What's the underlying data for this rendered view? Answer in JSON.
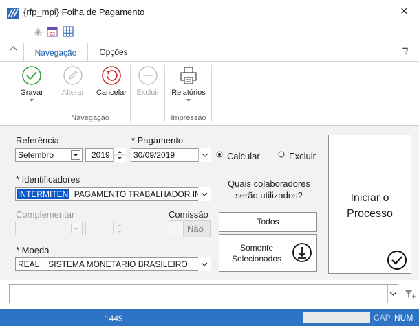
{
  "window": {
    "title": "{rfp_mpi} Folha de Pagamento",
    "close_glyph": "×"
  },
  "tabs": {
    "active": "Navegação",
    "other": "Opções",
    "help_glyph": "?",
    "more_glyph": "•••",
    "collapse_glyph": "^"
  },
  "ribbon": {
    "gravar": "Gravar",
    "alterar": "Alterar",
    "cancelar": "Cancelar",
    "excluir": "Excluir",
    "relatorios": "Relatórios",
    "group_navegacao": "Navegação",
    "group_impressao": "Impressão"
  },
  "form": {
    "referencia_label": "Referência",
    "mes": "Setembro",
    "ano": "2019",
    "pagamento_label": "* Pagamento",
    "pagamento": "30/09/2019",
    "radio_calcular": "Calcular",
    "radio_excluir": "Excluir",
    "identificadores_label": "* Identificadores",
    "identificador_codigo": "INTERMITEN",
    "identificador_desc": "PAGAMENTO TRABALHADOR INTE",
    "complementar_label": "Complementar",
    "comissao_label": "Comissão",
    "comissao_value": "Não",
    "moeda_label": "* Moeda",
    "moeda_codigo": "REAL",
    "moeda_desc": "SISTEMA MONETARIO BRASILEIRO",
    "question_line1": "Quais colaboradores",
    "question_line2": "serão utilizados?",
    "todos": "Todos",
    "somente_line1": "Somente",
    "somente_line2": "Selecionados",
    "iniciar_line1": "Iniciar o",
    "iniciar_line2": "Processo"
  },
  "status": {
    "count": "1449",
    "cap": "CAP",
    "num": "NUM"
  },
  "colors": {
    "accent": "#1f66b6",
    "status_bar": "#2f73c4",
    "green": "#2e9e36",
    "red": "#c8282d",
    "selection": "#0a58c7"
  },
  "icons": [
    "app-logo-icon",
    "pin-icon",
    "calendar-icon",
    "grid-icon",
    "check-circle-icon",
    "pencil-icon",
    "undo-icon",
    "minus-circle-icon",
    "printer-icon",
    "download-icon",
    "checkmark-icon",
    "filter-icon"
  ]
}
